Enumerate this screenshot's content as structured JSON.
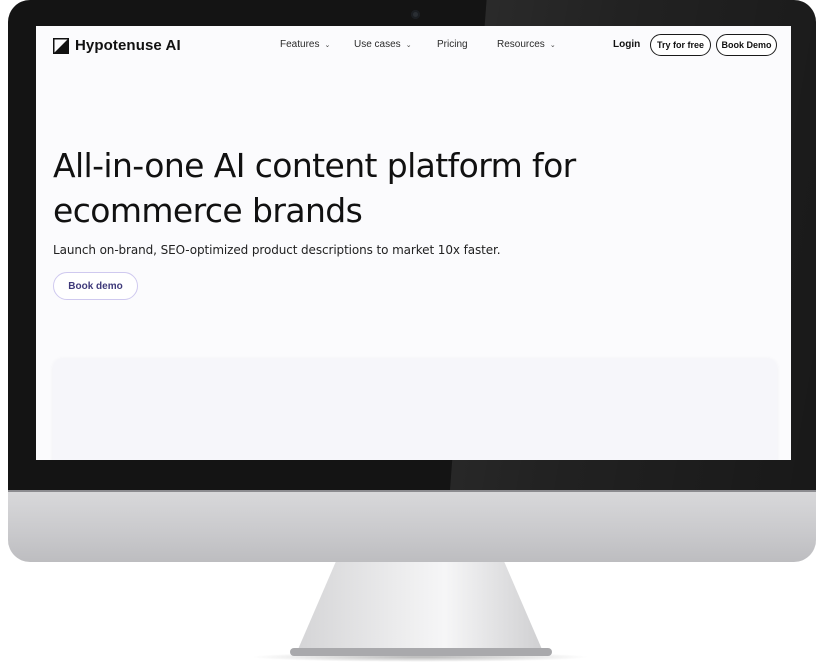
{
  "brand": {
    "logo_icon": "hypotenuse-triangle-logo-icon",
    "name": "Hypotenuse AI"
  },
  "nav": {
    "items": [
      {
        "label": "Features",
        "has_dropdown": true,
        "icon": "chevron-down-icon"
      },
      {
        "label": "Use cases",
        "has_dropdown": true,
        "icon": "chevron-down-icon"
      },
      {
        "label": "Pricing",
        "has_dropdown": false
      },
      {
        "label": "Resources",
        "has_dropdown": true,
        "icon": "chevron-down-icon"
      }
    ],
    "login_label": "Login",
    "try_free_label": "Try for free",
    "book_demo_label": "Book Demo"
  },
  "hero": {
    "headline": "All-in-one AI content platform for ecommerce brands",
    "subheadline": "Launch on-brand, SEO-optimized product descriptions to market 10x faster.",
    "cta_label": "Book demo"
  },
  "colors": {
    "bezel": "#141414",
    "screen_bg": "#fbfbfd",
    "text_primary": "#111111",
    "cta_text": "#3f3a7a",
    "cta_border": "#cfc9ef",
    "preview_card": "#f6f6fa"
  }
}
